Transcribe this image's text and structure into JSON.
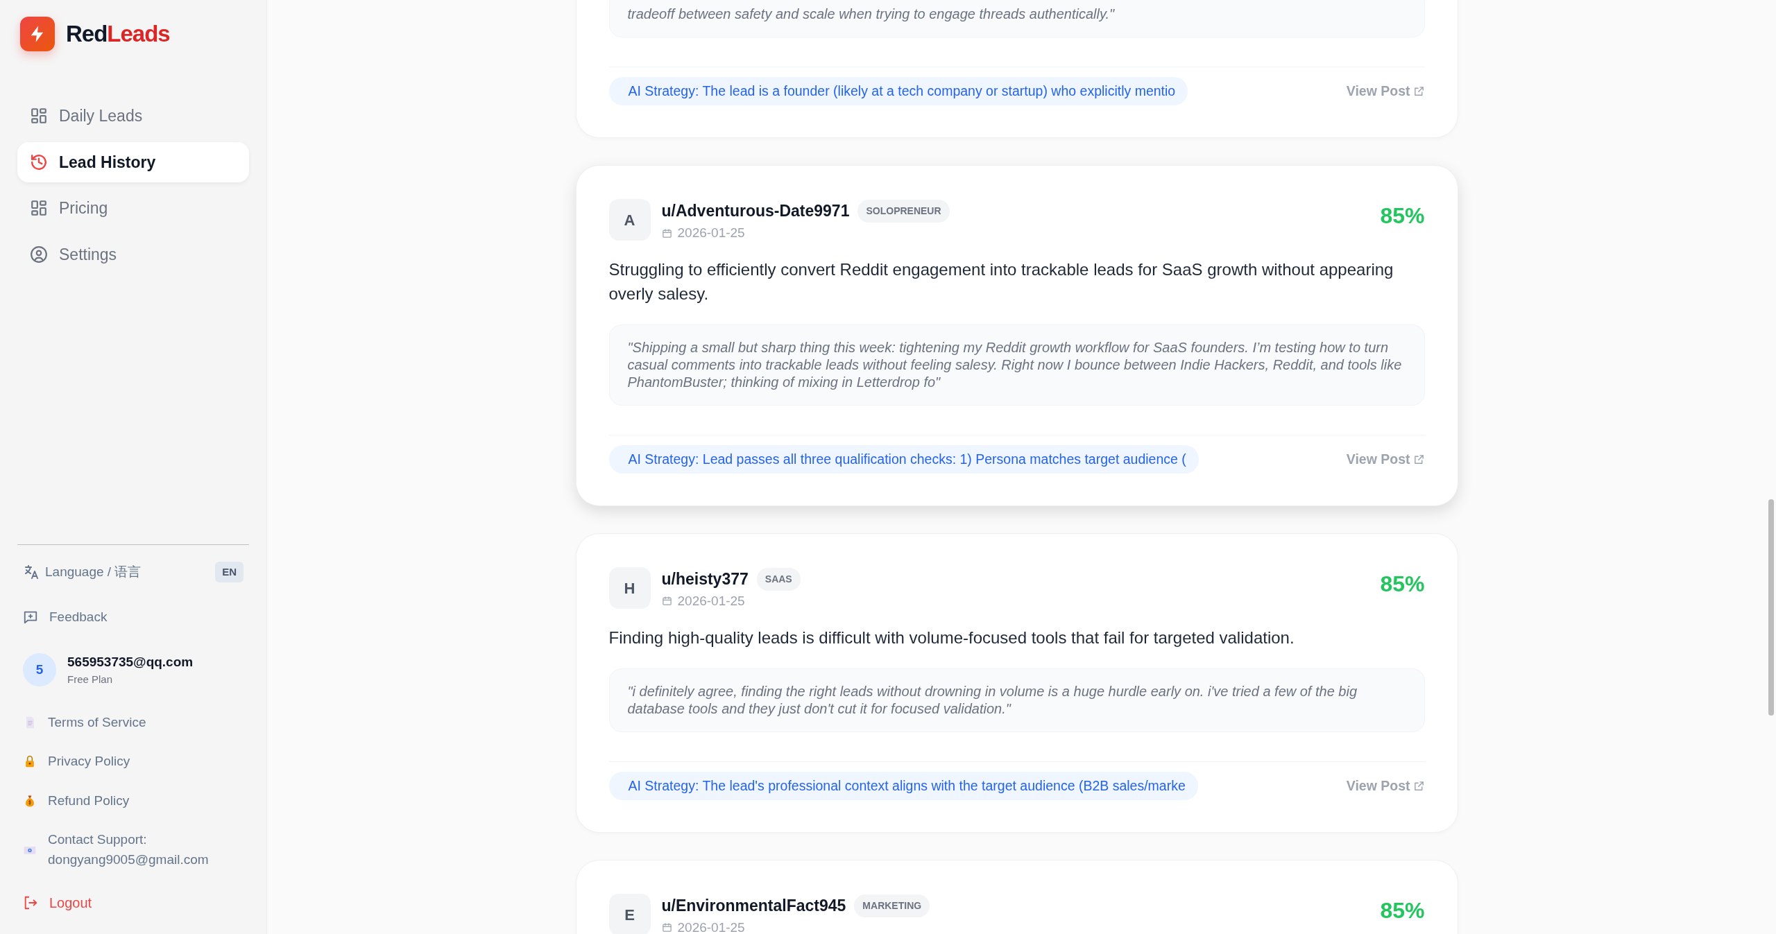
{
  "brand": {
    "name_dark": "Red",
    "name_accent": "Leads"
  },
  "nav": [
    {
      "label": "Daily Leads",
      "kind": "grid",
      "selected": false
    },
    {
      "label": "Lead History",
      "kind": "history",
      "selected": true
    },
    {
      "label": "Pricing",
      "kind": "grid",
      "selected": false
    },
    {
      "label": "Settings",
      "kind": "account",
      "selected": false
    }
  ],
  "language": {
    "label": "Language / 语言",
    "code": "EN"
  },
  "feedback": {
    "label": "Feedback"
  },
  "user": {
    "avatar": "5",
    "email": "565953735@qq.com",
    "plan": "Free Plan"
  },
  "links": [
    {
      "label": "Terms of Service",
      "kind": "terms"
    },
    {
      "label": "Privacy Policy",
      "kind": "privacy"
    },
    {
      "label": "Refund Policy",
      "kind": "refund"
    },
    {
      "label": "Contact Support: dongyang9005@gmail.com",
      "kind": "contact"
    }
  ],
  "logout": {
    "label": "Logout"
  },
  "leads": [
    {
      "quote": "tradeoff between safety and scale when trying to engage threads authentically.\"",
      "strategy": "AI Strategy: The lead is a founder (likely at a tech company or startup) who explicitly mentio",
      "view_label": "View Post",
      "highlighted": false
    },
    {
      "avatar": "A",
      "username": "u/Adventurous-Date9971",
      "tag": "SOLOPRENEUR",
      "date": "2026-01-25",
      "score": "85%",
      "summary": "Struggling to efficiently convert Reddit engagement into trackable leads for SaaS growth without appearing overly salesy.",
      "quote": "\"Shipping a small but sharp thing this week: tightening my Reddit growth workflow for SaaS founders. I’m testing how to turn casual comments into trackable leads without feeling salesy. Right now I bounce between Indie Hackers, Reddit, and tools like PhantomBuster; thinking of mixing in Letterdrop fo\"",
      "strategy": "AI Strategy: Lead passes all three qualification checks: 1) Persona matches target audience (",
      "view_label": "View Post",
      "highlighted": true
    },
    {
      "avatar": "H",
      "username": "u/heisty377",
      "tag": "SAAS",
      "date": "2026-01-25",
      "score": "85%",
      "summary": "Finding high-quality leads is difficult with volume-focused tools that fail for targeted validation.",
      "quote": "\"i definitely agree, finding the right leads without drowning in volume is a huge hurdle early on. i've tried a few of the big database tools and they just don't cut it for focused validation.\"",
      "strategy": "AI Strategy: The lead's professional context aligns with the target audience (B2B sales/marke",
      "view_label": "View Post",
      "highlighted": false
    },
    {
      "avatar": "E",
      "username": "u/EnvironmentalFact945",
      "tag": "MARKETING",
      "date": "2026-01-25",
      "score": "85%",
      "highlighted": false
    }
  ]
}
